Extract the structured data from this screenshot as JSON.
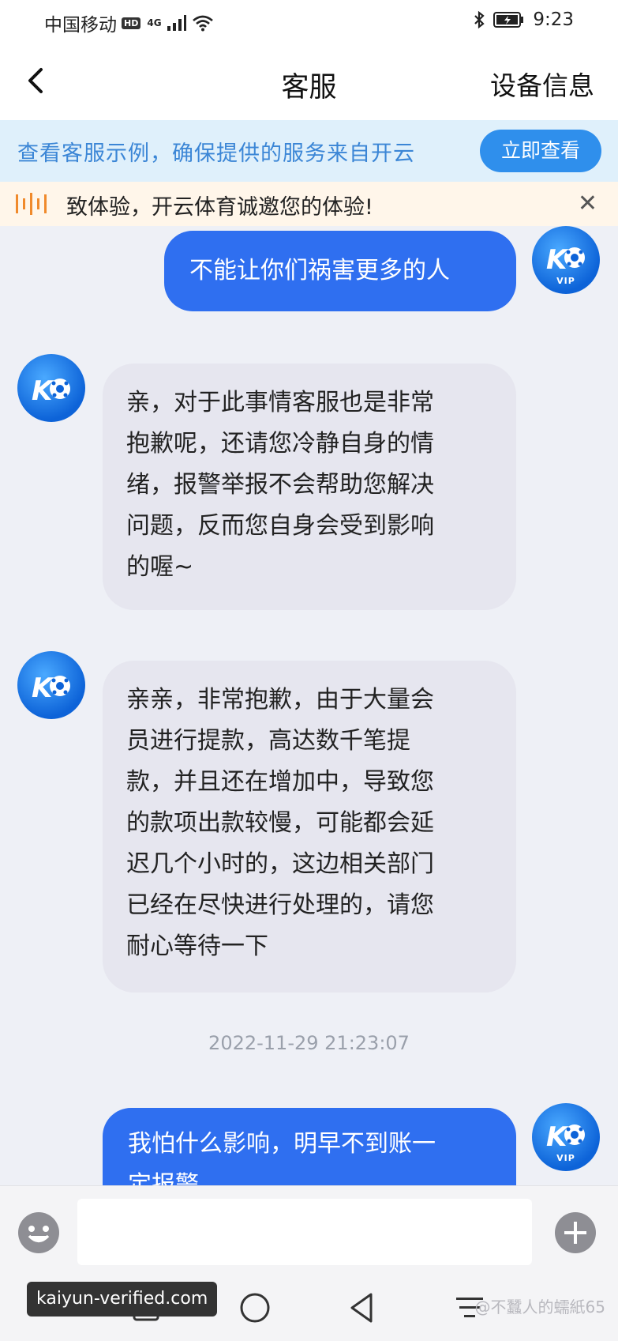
{
  "status_bar": {
    "carrier": "中国移动",
    "hd_badge": "HD",
    "network": "4G",
    "time": "9:23"
  },
  "header": {
    "title": "客服",
    "device_info": "设备信息"
  },
  "notice": {
    "text": "查看客服示例，确保提供的服务来自开云",
    "button": "立即查看"
  },
  "marquee": {
    "text": "致体验，开云体育诚邀您的体验!"
  },
  "avatar": {
    "vip_label": "VIP"
  },
  "messages": [
    {
      "side": "right",
      "lines": [
        "不能让你们祸害更多的人"
      ]
    },
    {
      "side": "left",
      "lines": [
        "亲，对于此事情客服也是非常",
        "抱歉呢，还请您冷静自身的情",
        "绪，报警举报不会帮助您解决",
        "问题，反而您自身会受到影响",
        "的喔~"
      ]
    },
    {
      "side": "left",
      "lines": [
        "亲亲，非常抱歉，由于大量会",
        "员进行提款，高达数千笔提",
        "款，并且还在增加中，导致您",
        "的款项出款较慢，可能都会延",
        "迟几个小时的，这边相关部门",
        "已经在尽快进行处理的，请您",
        "耐心等待一下"
      ]
    },
    {
      "side": "right",
      "lines": [
        "我怕什么影响，明早不到账一",
        "定报警"
      ]
    }
  ],
  "timestamp": "2022-11-29 21:23:07",
  "input": {
    "placeholder": ""
  },
  "watermarks": {
    "left": "kaiyun-verified.com",
    "right": "@不蠶人的蠕紙65"
  },
  "colors": {
    "accent_blue": "#2f6ff0",
    "notice_bg": "#dff0fb",
    "notice_text": "#3b86d6",
    "left_bubble": "#e6e6ef"
  }
}
